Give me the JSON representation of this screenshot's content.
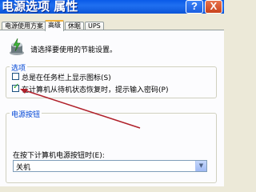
{
  "window": {
    "title": "电源选项 属性",
    "help_label": "?",
    "close_label": "X"
  },
  "tabs": [
    {
      "label": "电源使用方案",
      "active": false
    },
    {
      "label": "高级",
      "active": true
    },
    {
      "label": "休眠",
      "active": false
    },
    {
      "label": "UPS",
      "active": false
    }
  ],
  "intro_text": "请选择要使用的节能设置。",
  "options_group": {
    "label": "选项",
    "items": [
      {
        "label": "总是在任务栏上显示图标(S)",
        "checked": false
      },
      {
        "label": "在计算机从待机状态恢复时，提示输入密码(P)",
        "checked": true
      }
    ]
  },
  "power_buttons_group": {
    "label": "电源按钮",
    "select_label": "在按下计算机电源按钮时(E):",
    "select_value": "关机"
  },
  "icons": {
    "window_power": "power-options-icon",
    "dropdown": "chevron-down-icon"
  },
  "colors": {
    "titlebar": "#0a5be8",
    "active_tab_accent": "#f0b23c",
    "group_label": "#0046d5",
    "annotation_arrow": "#b0202a"
  }
}
